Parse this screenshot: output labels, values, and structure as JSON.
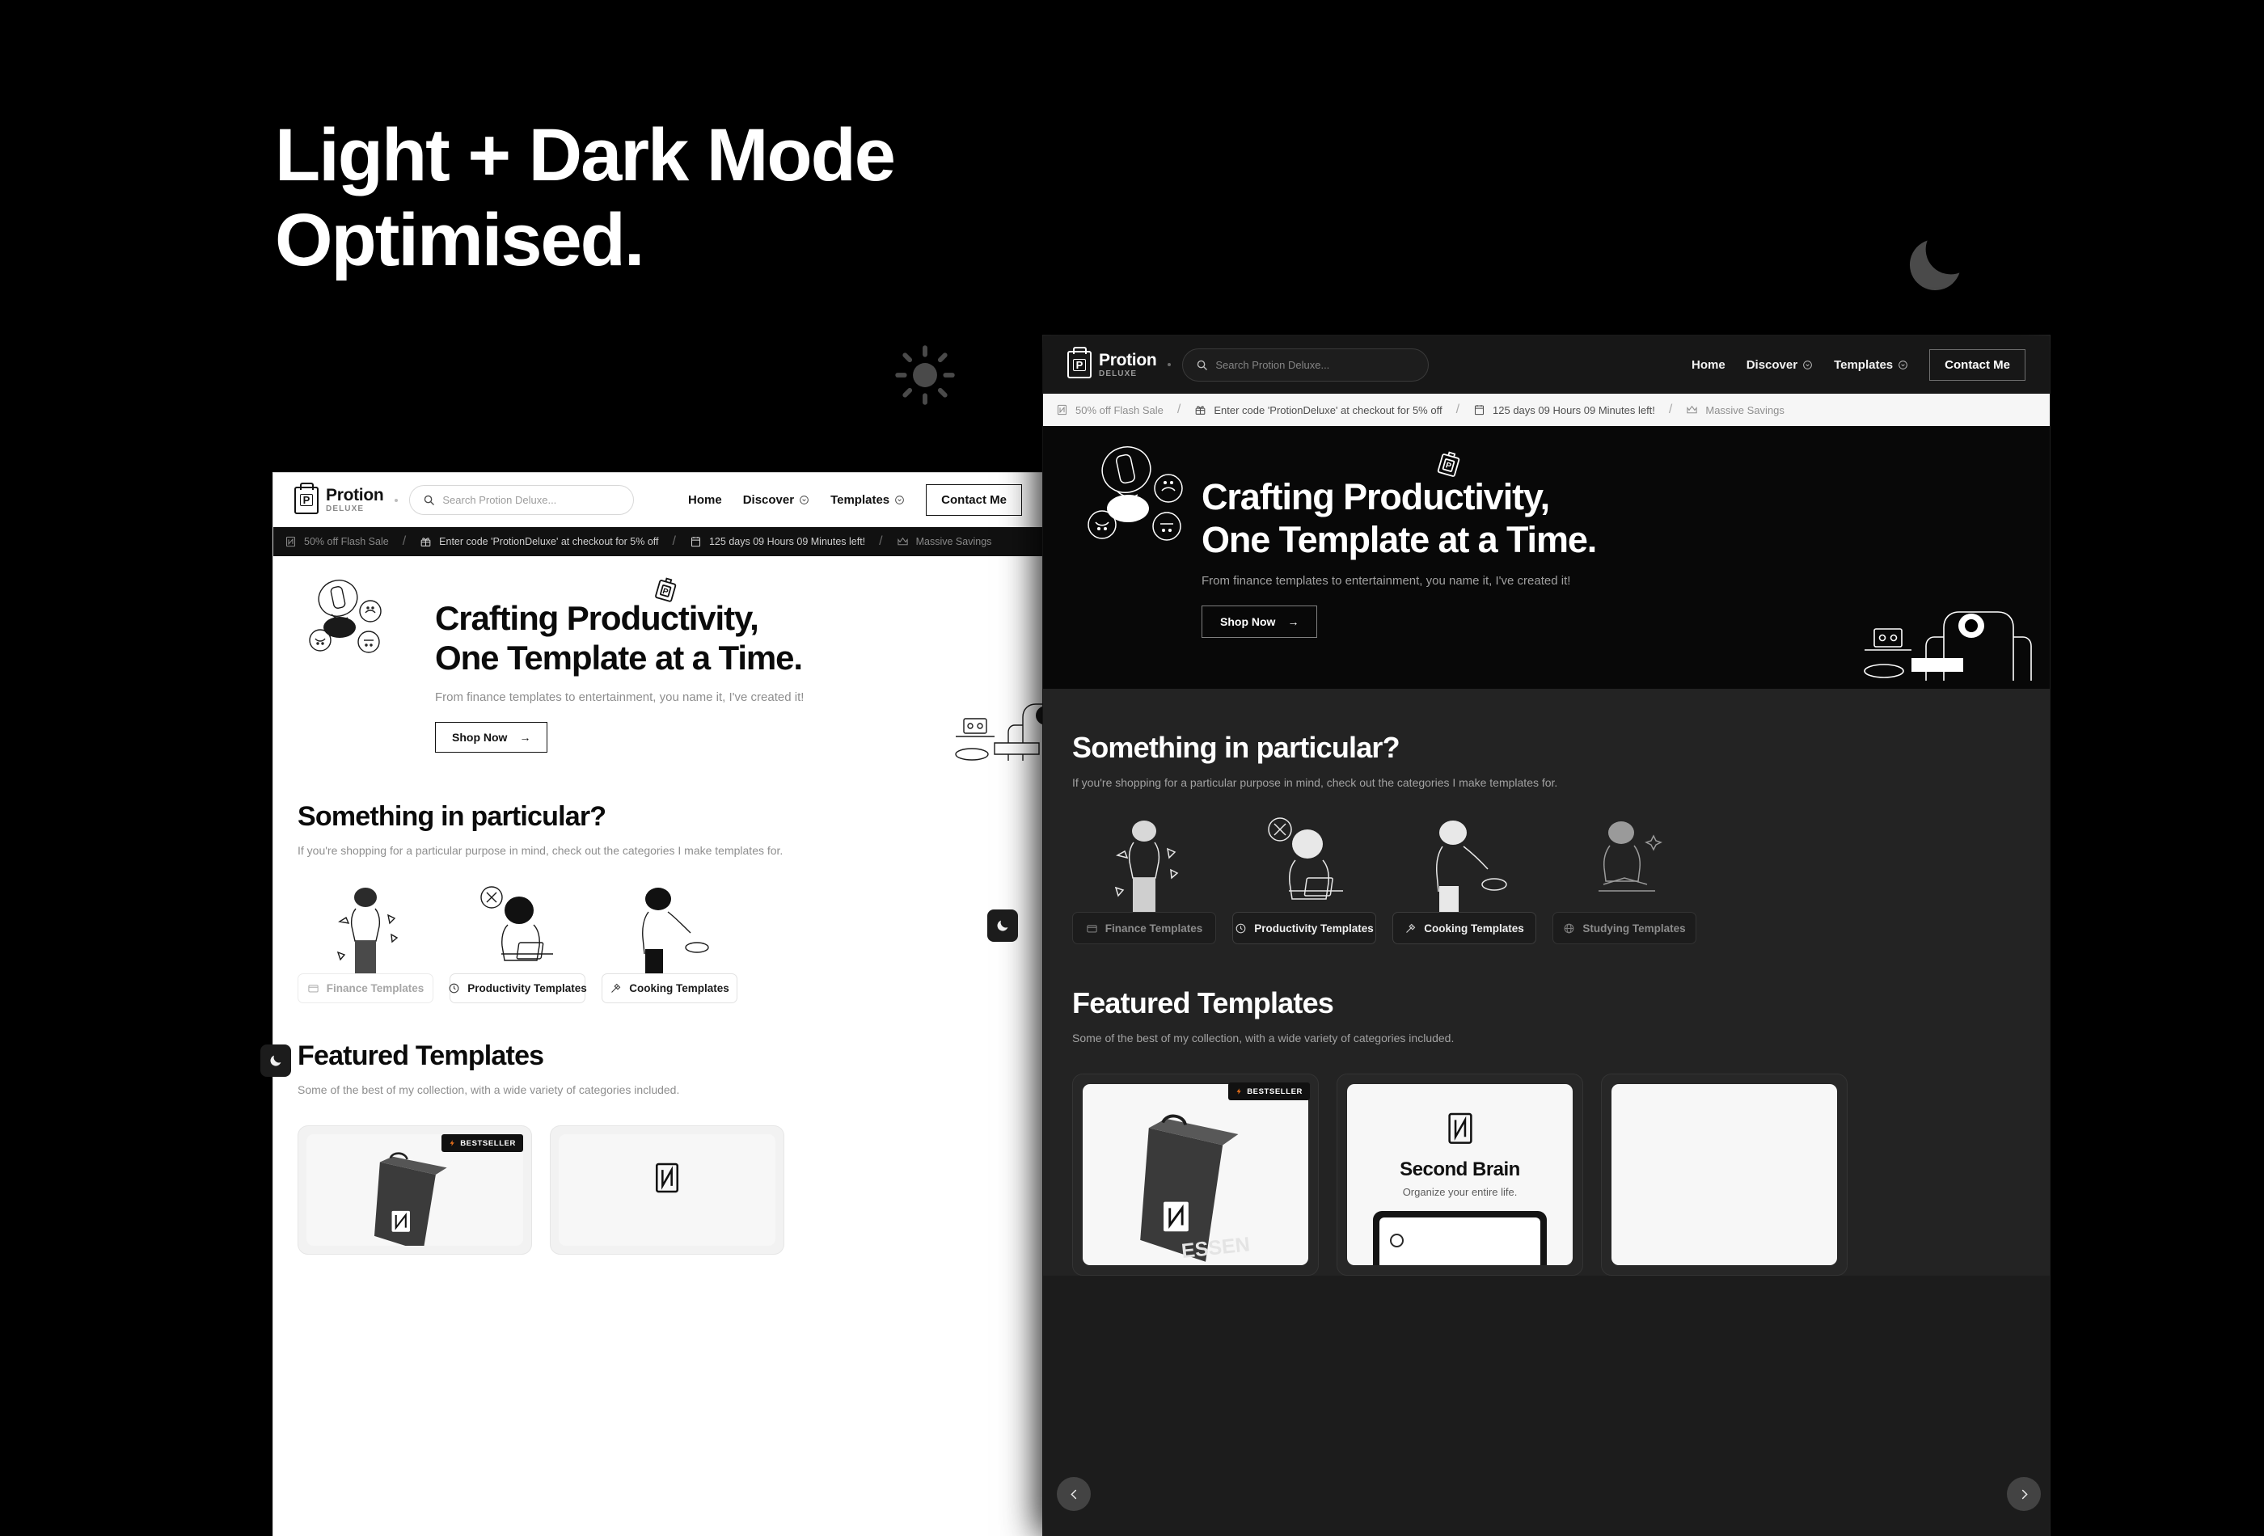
{
  "promo": {
    "headline_line1": "Light + Dark Mode",
    "headline_line2": "Optimised.",
    "sun_icon": "sun-icon",
    "moon_icon": "moon-icon"
  },
  "site": {
    "logo": {
      "mark_letter": "P",
      "title": "Protion",
      "subtitle": "DELUXE"
    },
    "search": {
      "placeholder": "Search Protion Deluxe...",
      "icon": "search-icon"
    },
    "nav": [
      {
        "label": "Home",
        "has_caret": false
      },
      {
        "label": "Discover",
        "has_caret": true
      },
      {
        "label": "Templates",
        "has_caret": true
      }
    ],
    "contact_button": "Contact Me",
    "ticker": [
      {
        "icon": "notion-icon",
        "text": "50% off Flash Sale",
        "faded": true
      },
      {
        "icon": "gift-icon",
        "text": "Enter code 'ProtionDeluxe' at checkout for 5% off",
        "faded": false
      },
      {
        "icon": "calendar-icon",
        "text": "125 days 09 Hours 09 Minutes left!",
        "faded": false
      },
      {
        "icon": "crown-icon",
        "text": "Massive Savings",
        "faded": true
      }
    ],
    "ticker_separator": "/",
    "hero": {
      "title_line1": "Crafting Productivity,",
      "title_line2": "One Template at a Time.",
      "subtitle": "From finance templates to entertainment, you name it, I've created it!",
      "cta": "Shop Now",
      "cta_arrow": "→"
    },
    "categories_section": {
      "title": "Something in particular?",
      "subtitle": "If you're shopping for a particular purpose in mind, check out the categories I make templates for.",
      "items": [
        {
          "label": "Finance Templates",
          "icon": "wallet-icon",
          "muted": true
        },
        {
          "label": "Productivity Templates",
          "icon": "clock-icon",
          "muted": false
        },
        {
          "label": "Cooking Templates",
          "icon": "spatula-icon",
          "muted": false
        },
        {
          "label": "Studying Templates",
          "icon": "globe-icon",
          "muted": true
        }
      ]
    },
    "featured_section": {
      "title": "Featured Templates",
      "subtitle": "Some of the best of my collection, with a wide variety of categories included.",
      "cards": [
        {
          "badge": "BESTSELLER",
          "badge_icon": "bolt-icon",
          "art": "bag-art",
          "caption": "ESSEN"
        },
        {
          "title": "Second Brain",
          "subtitle": "Organize your entire life.",
          "art": "notion-logo"
        },
        {
          "title": "",
          "subtitle": "",
          "art": "blank"
        }
      ]
    },
    "mode_toggle_icon": "moon-icon",
    "carousel": {
      "prev_icon": "chevron-left-icon",
      "next_icon": "chevron-right-icon"
    }
  },
  "colors": {
    "background": "#000000",
    "light_surface": "#ffffff",
    "dark_surface": "#1c1c1c",
    "dark_section": "#232323",
    "hero_dark": "#080808",
    "accent_orange": "#e8701a"
  }
}
